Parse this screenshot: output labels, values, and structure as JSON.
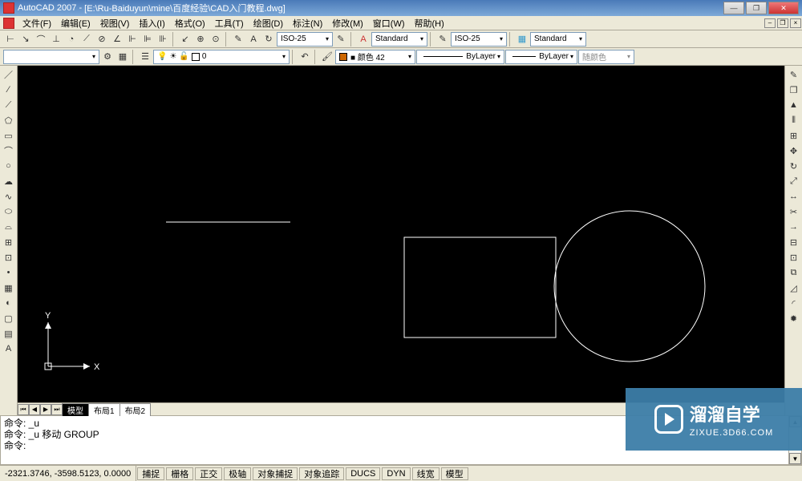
{
  "titlebar": {
    "app": "AutoCAD 2007",
    "doc": "[E:\\Ru-Baiduyun\\mine\\百度经验\\CAD入门教程.dwg]"
  },
  "menu": {
    "items": [
      "文件(F)",
      "编辑(E)",
      "视图(V)",
      "插入(I)",
      "格式(O)",
      "工具(T)",
      "绘图(D)",
      "标注(N)",
      "修改(M)",
      "窗口(W)",
      "帮助(H)"
    ]
  },
  "toolbar_row1": {
    "dimstyle": "ISO-25",
    "textstyle_a": "Standard",
    "dimstyle2": "ISO-25",
    "tablestyle": "Standard"
  },
  "toolbar_row2": {
    "color_label": "■ 颜色 42",
    "linetype": "ByLayer",
    "lineweight": "ByLayer",
    "plotstyle": "随颜色"
  },
  "layers": {
    "current": "0"
  },
  "tabs": {
    "items": [
      "模型",
      "布局1",
      "布局2"
    ]
  },
  "command": {
    "line1": "命令: _u",
    "line2": "命令: _u 移动 GROUP",
    "line3": "",
    "prompt": "命令:"
  },
  "status": {
    "coords": "-2321.3746, -3598.5123, 0.0000",
    "toggles": [
      "捕捉",
      "栅格",
      "正交",
      "极轴",
      "对象捕捉",
      "对象追踪",
      "DUCS",
      "DYN",
      "线宽",
      "模型"
    ]
  },
  "ucs": {
    "x": "X",
    "y": "Y"
  },
  "watermark": {
    "brand": "溜溜自学",
    "url": "ZIXUE.3D66.COM"
  }
}
